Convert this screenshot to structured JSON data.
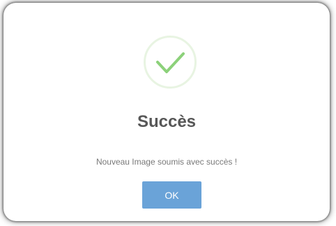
{
  "dialog": {
    "icon": "success-check-icon",
    "title": "Succès",
    "message": "Nouveau Image soumis avec succès !",
    "ok_label": "OK"
  },
  "colors": {
    "success": "#8cd17a",
    "success_ring": "#e8f4e2",
    "button": "#6aa3d8",
    "title_text": "#575757",
    "message_text": "#797979"
  }
}
